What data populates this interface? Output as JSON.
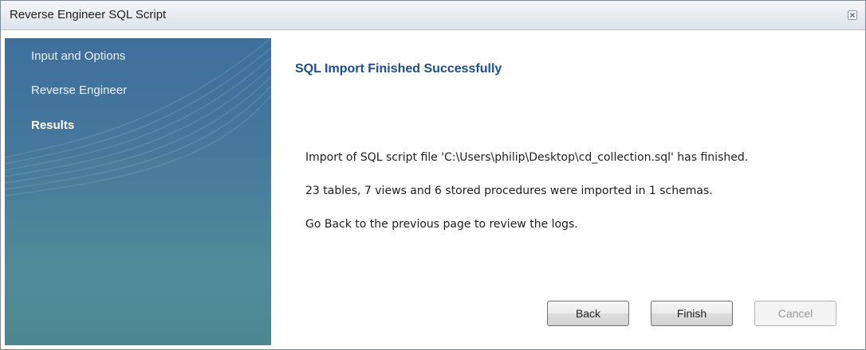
{
  "window": {
    "title": "Reverse Engineer SQL Script",
    "close_icon": "close-icon"
  },
  "sidebar": {
    "items": [
      {
        "label": "Input and Options",
        "active": false
      },
      {
        "label": "Reverse Engineer",
        "active": false
      },
      {
        "label": "Results",
        "active": true
      }
    ],
    "colors": {
      "top": "#3f6f9d",
      "bottom": "#4d8790"
    }
  },
  "main": {
    "heading": "SQL Import Finished Successfully",
    "messages": [
      "Import of SQL script file 'C:\\Users\\philip\\Desktop\\cd_collection.sql' has finished.",
      "23 tables, 7 views and 6 stored procedures were imported in 1 schemas.",
      "Go Back to the previous page to review the logs."
    ]
  },
  "buttons": {
    "back": "Back",
    "finish": "Finish",
    "cancel": "Cancel",
    "cancel_enabled": false
  },
  "colors": {
    "heading": "#1b4f8f",
    "border": "#7a8a99"
  }
}
